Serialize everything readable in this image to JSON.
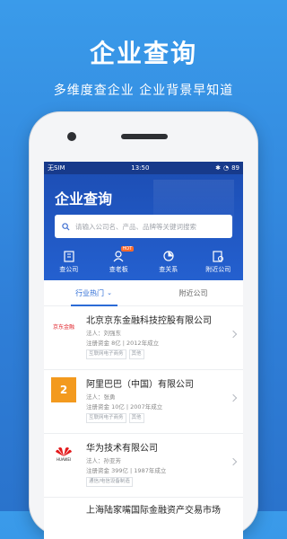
{
  "promo": {
    "title": "企业查询",
    "subtitle": "多维度查企业  企业背景早知道"
  },
  "status": {
    "carrier": "无SIM",
    "time": "13:50",
    "battery": "89"
  },
  "app": {
    "title": "企业查询",
    "search_placeholder": "请输入公司名、产品、品牌等关键词搜索",
    "quick": [
      {
        "label": "查公司",
        "icon": "company-icon"
      },
      {
        "label": "查老板",
        "icon": "boss-icon",
        "badge": "HOT"
      },
      {
        "label": "查关系",
        "icon": "relation-icon"
      },
      {
        "label": "附近公司",
        "icon": "nearby-icon"
      }
    ],
    "tabs": [
      {
        "label": "行业热门",
        "active": true
      },
      {
        "label": "附近公司",
        "active": false
      }
    ],
    "companies": [
      {
        "name": "北京京东金融科技控股有限公司",
        "rep": "法人：刘强东",
        "reg": "注册资金 8亿 | 2012年成立",
        "tags": [
          "互联网电子商务",
          "其他"
        ],
        "logo": "jd-finance-logo",
        "logo_text": "京东金融"
      },
      {
        "name": "阿里巴巴（中国）有限公司",
        "rep": "法人：张勇",
        "reg": "注册资金 10亿 | 2007年成立",
        "tags": [
          "互联网电子商务",
          "其他"
        ],
        "logo": "alibaba-logo",
        "logo_text": "2"
      },
      {
        "name": "华为技术有限公司",
        "rep": "法人：孙亚芳",
        "reg": "注册资金 399亿 | 1987年成立",
        "tags": [
          "通信/电信设备制造"
        ],
        "logo": "huawei-logo",
        "logo_text": "HUAWEI"
      },
      {
        "name": "上海陆家嘴国际金融资产交易市场"
      }
    ]
  }
}
